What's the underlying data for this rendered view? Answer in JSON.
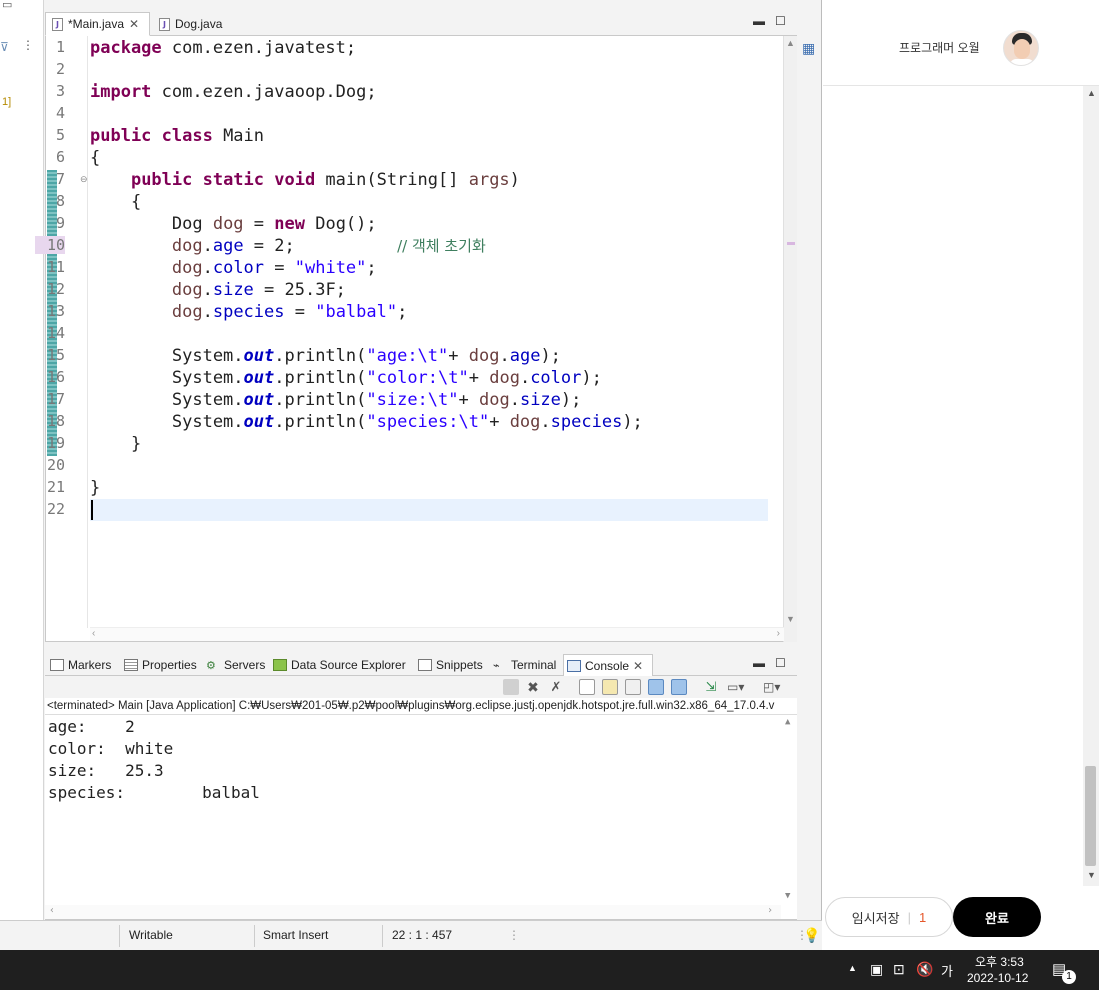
{
  "editor": {
    "tabs": [
      {
        "label": "*Main.java",
        "active": true
      },
      {
        "label": "Dog.java",
        "active": false
      }
    ],
    "line_numbers": [
      "1",
      "2",
      "3",
      "4",
      "5",
      "6",
      "7",
      "8",
      "9",
      "10",
      "11",
      "12",
      "13",
      "14",
      "15",
      "16",
      "17",
      "18",
      "19",
      "20",
      "21",
      "22"
    ],
    "left_strip_text": "1]"
  },
  "code": {
    "l1_kw": "package",
    "l1_rest": " com.ezen.javatest;",
    "l3_kw": "import",
    "l3_rest": " com.ezen.javaoop.Dog;",
    "l5_kw": "public class",
    "l5_rest": " Main",
    "l6": "{",
    "l7_indent": "    ",
    "l7_kw": "public static void",
    "l7_rest": " main(String[] ",
    "l7_var": "args",
    "l7_end": ")",
    "l8": "    {",
    "l9_a": "        Dog ",
    "l9_var": "dog",
    "l9_b": " = ",
    "l9_kw": "new",
    "l9_c": " Dog();",
    "l10_var": "        dog",
    "l10_dot": ".",
    "l10_fld": "age",
    "l10_rest": " = 2;          ",
    "l10_cmt": "// 객체 초기화",
    "l11_var": "        dog",
    "l11_dot": ".",
    "l11_fld": "color",
    "l11_rest": " = ",
    "l11_str": "\"white\"",
    "l11_end": ";",
    "l12_var": "        dog",
    "l12_dot": ".",
    "l12_fld": "size",
    "l12_rest": " = 25.3F;",
    "l13_var": "        dog",
    "l13_dot": ".",
    "l13_fld": "species",
    "l13_rest": " = ",
    "l13_str": "\"balbal\"",
    "l13_end": ";",
    "l15_a": "        System.",
    "l15_out": "out",
    "l15_b": ".println(",
    "l15_str": "\"age:\\t\"",
    "l15_c": "+ ",
    "l15_var": "dog",
    "l15_d": ".",
    "l15_fld": "age",
    "l15_e": ");",
    "l16_a": "        System.",
    "l16_out": "out",
    "l16_b": ".println(",
    "l16_str": "\"color:\\t\"",
    "l16_c": "+ ",
    "l16_var": "dog",
    "l16_d": ".",
    "l16_fld": "color",
    "l16_e": ");",
    "l17_a": "        System.",
    "l17_out": "out",
    "l17_b": ".println(",
    "l17_str": "\"size:\\t\"",
    "l17_c": "+ ",
    "l17_var": "dog",
    "l17_d": ".",
    "l17_fld": "size",
    "l17_e": ");",
    "l18_a": "        System.",
    "l18_out": "out",
    "l18_b": ".println(",
    "l18_str": "\"species:\\t\"",
    "l18_c": "+ ",
    "l18_var": "dog",
    "l18_d": ".",
    "l18_fld": "species",
    "l18_e": ");",
    "l19": "    }",
    "l21": "}"
  },
  "views": {
    "tabs": [
      "Markers",
      "Properties",
      "Servers",
      "Data Source Explorer",
      "Snippets",
      "Terminal",
      "Console"
    ],
    "active": "Console"
  },
  "console": {
    "description": "<terminated> Main [Java Application] C:₩Users₩201-05₩.p2₩pool₩plugins₩org.eclipse.justj.openjdk.hotspot.jre.full.win32.x86_64_17.0.4.v",
    "output": [
      "age:    2",
      "color:  white",
      "size:   25.3",
      "species:        balbal"
    ]
  },
  "statusbar": {
    "writable": "Writable",
    "insert_mode": "Smart Insert",
    "position": "22 : 1 : 457"
  },
  "web": {
    "username": "프로그래머 오월",
    "draft_label": "임시저장",
    "draft_count": "1",
    "done_label": "완료"
  },
  "taskbar": {
    "ime": "가",
    "time": "오후 3:53",
    "date": "2022-10-12",
    "notification_count": "1"
  },
  "colors": {
    "keyword": "#7f0055",
    "field": "#0000c0",
    "string": "#2a00ff",
    "comment": "#3f7f5f",
    "current_line": "#e8f2fe",
    "done_button": "#000000"
  }
}
